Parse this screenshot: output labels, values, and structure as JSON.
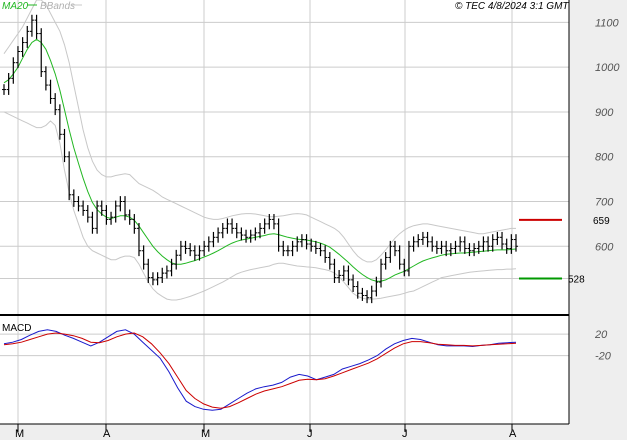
{
  "header": {
    "ma_label": "MA20",
    "bb_label": "BBands",
    "copyright": "© TEC 4/8/2024 3:1 GMT"
  },
  "colors": {
    "background": "#ffffff",
    "grid": "#cccccc",
    "axis_panel": "#eeeeee",
    "price": "#000000",
    "ma": "#22b722",
    "bbands": "#c8c8c8",
    "resistance": "#cc0000",
    "support": "#009900",
    "macd": "#1a1acc",
    "signal": "#cc0000"
  },
  "chart_data": [
    {
      "type": "ohlc",
      "panel": "price",
      "x_ticks": [
        "M",
        "A",
        "M",
        "J",
        "J",
        "A"
      ],
      "y_ticks": [
        1100,
        1000,
        900,
        800,
        700,
        600
      ],
      "ylim": [
        480,
        1150
      ],
      "grid": true,
      "closes": [
        950,
        975,
        1010,
        1035,
        1055,
        1080,
        1105,
        1075,
        990,
        960,
        930,
        905,
        850,
        800,
        715,
        700,
        690,
        680,
        665,
        640,
        690,
        680,
        660,
        665,
        690,
        700,
        670,
        660,
        640,
        590,
        560,
        530,
        525,
        530,
        540,
        545,
        560,
        580,
        600,
        595,
        590,
        580,
        590,
        600,
        610,
        620,
        630,
        640,
        650,
        640,
        630,
        625,
        620,
        625,
        630,
        640,
        650,
        660,
        650,
        600,
        590,
        590,
        600,
        610,
        615,
        605,
        600,
        595,
        590,
        575,
        560,
        530,
        535,
        545,
        525,
        510,
        495,
        490,
        485,
        500,
        520,
        560,
        575,
        600,
        590,
        560,
        545,
        600,
        610,
        615,
        620,
        610,
        600,
        595,
        600,
        590,
        595,
        600,
        610,
        595,
        590,
        595,
        600,
        610,
        600,
        615,
        620,
        605,
        595,
        615,
        600
      ],
      "ma20": [
        965,
        972,
        985,
        1000,
        1020,
        1040,
        1055,
        1062,
        1055,
        1040,
        1015,
        985,
        948,
        905,
        860,
        820,
        785,
        752,
        722,
        698,
        682,
        672,
        665,
        662,
        665,
        668,
        668,
        665,
        658,
        645,
        630,
        615,
        600,
        588,
        578,
        570,
        563,
        560,
        560,
        562,
        565,
        568,
        572,
        576,
        580,
        585,
        590,
        596,
        602,
        607,
        611,
        614,
        616,
        618,
        620,
        622,
        624,
        627,
        628,
        626,
        623,
        620,
        618,
        616,
        615,
        614,
        612,
        610,
        607,
        603,
        598,
        590,
        582,
        573,
        564,
        554,
        545,
        537,
        530,
        525,
        522,
        522,
        525,
        530,
        536,
        540,
        544,
        550,
        556,
        562,
        567,
        571,
        574,
        577,
        580,
        582,
        583,
        584,
        585,
        585,
        586,
        587,
        588,
        589,
        590,
        591,
        592,
        592,
        592,
        593,
        594
      ],
      "bb_upper": [
        1030,
        1045,
        1060,
        1075,
        1090,
        1110,
        1130,
        1150,
        1150,
        1140,
        1120,
        1100,
        1080,
        1050,
        1010,
        960,
        910,
        860,
        820,
        790,
        770,
        760,
        755,
        755,
        758,
        760,
        762,
        760,
        750,
        740,
        735,
        730,
        725,
        718,
        710,
        705,
        700,
        695,
        690,
        685,
        680,
        675,
        670,
        665,
        662,
        660,
        660,
        662,
        665,
        668,
        670,
        672,
        673,
        673,
        672,
        670,
        668,
        666,
        666,
        667,
        668,
        670,
        672,
        673,
        672,
        670,
        665,
        660,
        655,
        650,
        645,
        640,
        632,
        620,
        605,
        590,
        578,
        570,
        565,
        565,
        570,
        580,
        592,
        605,
        618,
        628,
        636,
        642,
        646,
        648,
        650,
        650,
        648,
        646,
        644,
        642,
        640,
        638,
        636,
        634,
        632,
        630,
        628,
        628,
        630,
        632,
        634,
        636,
        638,
        640,
        640
      ],
      "bb_lower": [
        900,
        895,
        890,
        885,
        880,
        875,
        870,
        865,
        865,
        870,
        880,
        870,
        830,
        770,
        720,
        680,
        650,
        620,
        600,
        590,
        585,
        580,
        575,
        570,
        570,
        575,
        578,
        578,
        575,
        560,
        540,
        520,
        505,
        495,
        488,
        482,
        480,
        480,
        482,
        485,
        488,
        492,
        496,
        500,
        505,
        510,
        515,
        520,
        526,
        532,
        538,
        542,
        545,
        548,
        550,
        552,
        554,
        556,
        560,
        562,
        562,
        560,
        558,
        556,
        555,
        554,
        553,
        552,
        550,
        548,
        545,
        540,
        532,
        520,
        508,
        495,
        488,
        484,
        482,
        482,
        483,
        484,
        486,
        488,
        490,
        492,
        495,
        498,
        500,
        505,
        510,
        515,
        520,
        525,
        530,
        532,
        534,
        536,
        538,
        540,
        542,
        543,
        544,
        545,
        546,
        547,
        548,
        548,
        549,
        549,
        550
      ],
      "levels": [
        {
          "name": "resistance",
          "value": 659,
          "label": "659"
        },
        {
          "name": "support",
          "value": 528,
          "label": "528"
        }
      ]
    },
    {
      "type": "line",
      "panel": "macd",
      "title": "MACD",
      "y_ticks": [
        20,
        -20
      ],
      "y_tick_labels": [
        "20",
        "-20"
      ],
      "ylim": [
        -140,
        50
      ],
      "series": [
        {
          "name": "macd",
          "values": [
            2,
            5,
            10,
            18,
            25,
            28,
            25,
            18,
            12,
            5,
            -2,
            5,
            15,
            25,
            28,
            20,
            5,
            -10,
            -25,
            -50,
            -80,
            -105,
            -115,
            -120,
            -122,
            -120,
            -110,
            -100,
            -90,
            -82,
            -78,
            -75,
            -70,
            -60,
            -55,
            -58,
            -65,
            -60,
            -55,
            -45,
            -40,
            -35,
            -28,
            -20,
            -8,
            2,
            8,
            12,
            10,
            5,
            0,
            -2,
            -2,
            -2,
            -3,
            -1,
            0,
            3,
            4,
            5
          ]
        },
        {
          "name": "signal",
          "values": [
            0,
            2,
            5,
            10,
            15,
            20,
            22,
            20,
            17,
            12,
            5,
            4,
            8,
            15,
            20,
            22,
            15,
            2,
            -15,
            -35,
            -60,
            -85,
            -100,
            -110,
            -116,
            -118,
            -115,
            -108,
            -100,
            -92,
            -86,
            -82,
            -78,
            -72,
            -66,
            -64,
            -65,
            -63,
            -58,
            -52,
            -46,
            -40,
            -34,
            -26,
            -16,
            -6,
            2,
            6,
            6,
            4,
            1,
            0,
            -1,
            -1,
            -2,
            -1,
            0,
            1,
            2,
            3
          ]
        }
      ]
    }
  ]
}
